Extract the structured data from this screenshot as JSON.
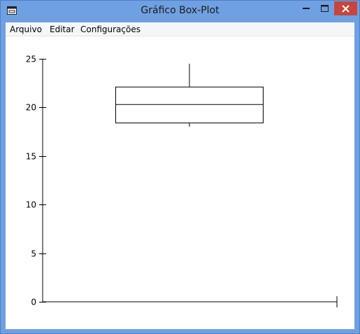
{
  "window": {
    "title": "Gráfico Box-Plot",
    "titlebar_color": "#6fa0e2",
    "close_button_color": "#c7463b"
  },
  "menu": {
    "items": [
      "Arquivo",
      "Editar",
      "Configurações"
    ]
  },
  "chart_data": {
    "type": "boxplot",
    "title": "",
    "xlabel": "",
    "ylabel": "",
    "ylim": [
      0,
      25
    ],
    "yticks": [
      0,
      5,
      10,
      15,
      20,
      25
    ],
    "grid": false,
    "box": {
      "whisker_low": 18.0,
      "q1": 18.4,
      "median": 20.3,
      "q3": 22.1,
      "whisker_high": 24.5
    }
  }
}
